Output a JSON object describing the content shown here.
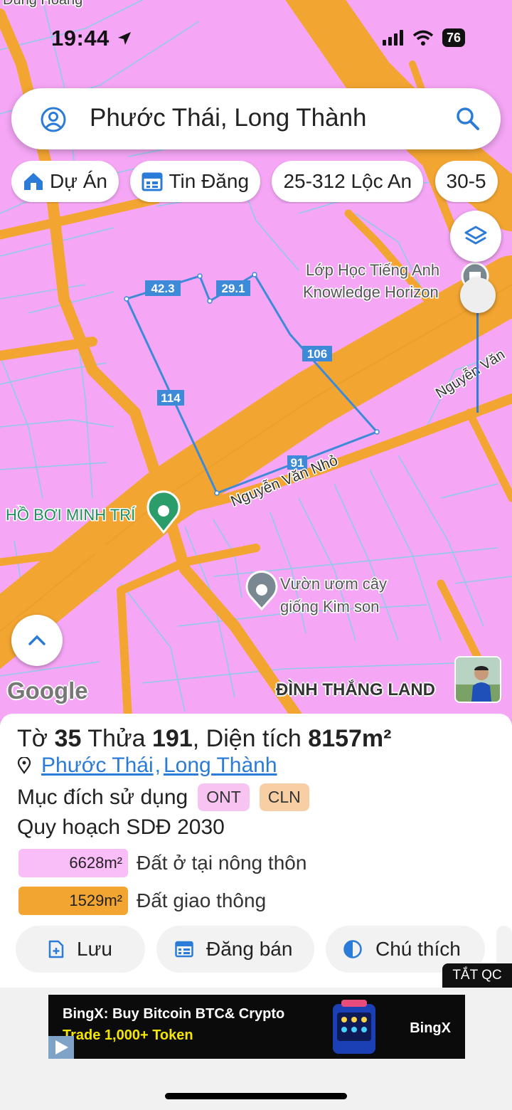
{
  "status_bar": {
    "time": "19:44",
    "battery": "76"
  },
  "search": {
    "query": "Phước Thái, Long Thành"
  },
  "chips": [
    {
      "label": "Dự Án",
      "icon": "home-icon"
    },
    {
      "label": "Tin Đăng",
      "icon": "calendar-icon"
    },
    {
      "label": "25-312 Lộc An",
      "icon": ""
    },
    {
      "label": "30-5",
      "icon": ""
    }
  ],
  "map": {
    "edge_labels": {
      "top": "42.3",
      "top2": "29.1",
      "right": "106",
      "left": "114",
      "bottom": "91"
    },
    "pois": {
      "school_line1": "Lớp Học Tiếng Anh",
      "school_line2": "Knowledge Horizon",
      "pool": "HỒ BƠI MINH TRÍ",
      "nursery_line1": "Vườn ươm cây",
      "nursery_line2": "giống Kim son"
    },
    "roads": {
      "main": "Nguyễn Văn Nhỏ",
      "right": "Nguyễn Văn",
      "top_cut": "Dũng Hoàng"
    },
    "google_logo": "Google",
    "watermark": "ĐÌNH THẮNG LAND",
    "colors": {
      "land": "#f5a6f5",
      "road": "#f3a531",
      "parcel": "#3d8ad9",
      "grid": "#7ad4e8"
    }
  },
  "parcel_info": {
    "title_prefix": "Tờ",
    "sheet_no": "35",
    "title_mid": "Thửa",
    "plot_no": "191",
    "title_area_label": ", Diện tích",
    "area": "8157m²",
    "ward": "Phước Thái",
    "separator": ",",
    "district": "Long Thành",
    "purpose_label": "Mục đích sử dụng",
    "purpose_tags": [
      {
        "code": "ONT",
        "color": "#f7c4f2"
      },
      {
        "code": "CLN",
        "color": "#f8cfa4"
      }
    ],
    "plan_label": "Quy hoạch SDĐ 2030",
    "plan_rows": [
      {
        "area": "6628m²",
        "label": "Đất ở tại nông thôn",
        "color": "#f9bdf7"
      },
      {
        "area": "1529m²",
        "label": "Đất giao thông",
        "color": "#f3a531"
      }
    ]
  },
  "actions": [
    {
      "label": "Lưu",
      "icon": "file-plus-icon"
    },
    {
      "label": "Đăng bán",
      "icon": "calendar-icon"
    },
    {
      "label": "Chú thích",
      "icon": "contrast-icon"
    }
  ],
  "ad": {
    "hide_label": "TẮT QC",
    "line1": "BingX: Buy Bitcoin BTC& Crypto",
    "line2": "Trade 1,000+ Token",
    "brand": "BingX"
  }
}
